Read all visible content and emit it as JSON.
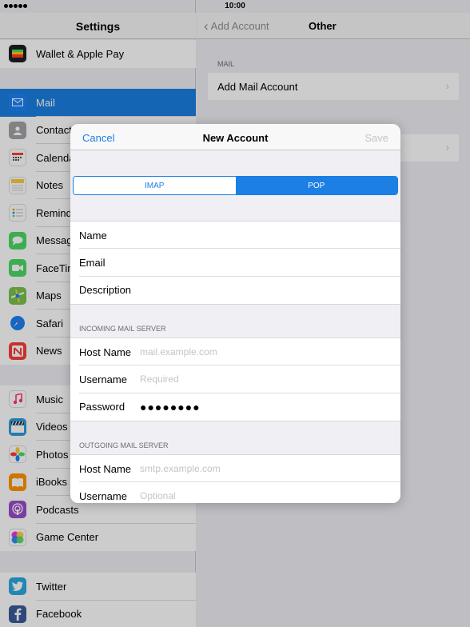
{
  "status_bar": {
    "time": "10:00"
  },
  "master": {
    "title": "Settings",
    "groups": [
      [
        {
          "label": "Wallet & Apple Pay",
          "icon": "wallet-icon",
          "color": "#1f1f1f"
        }
      ],
      [
        {
          "label": "Mail",
          "icon": "mail-icon",
          "color": "#1a82f7"
        },
        {
          "label": "Contacts",
          "icon": "contacts-icon",
          "color": "#8e8e93"
        },
        {
          "label": "Calendar",
          "icon": "calendar-icon",
          "color": "#ffffff"
        },
        {
          "label": "Notes",
          "icon": "notes-icon",
          "color": "#fccb3e"
        },
        {
          "label": "Reminders",
          "icon": "reminders-icon",
          "color": "#ffffff"
        },
        {
          "label": "Messages",
          "icon": "messages-icon",
          "color": "#4cd964"
        },
        {
          "label": "FaceTime",
          "icon": "facetime-icon",
          "color": "#4cd964"
        },
        {
          "label": "Maps",
          "icon": "maps-icon",
          "color": "#7ac24d"
        },
        {
          "label": "Safari",
          "icon": "safari-icon",
          "color": "#1a82f7"
        },
        {
          "label": "News",
          "icon": "news-icon",
          "color": "#fc3d39"
        }
      ],
      [
        {
          "label": "Music",
          "icon": "music-icon",
          "color": "#ffffff"
        },
        {
          "label": "Videos",
          "icon": "videos-icon",
          "color": "#2d9cdb"
        },
        {
          "label": "Photos",
          "icon": "photos-icon",
          "color": "#ffffff"
        },
        {
          "label": "iBooks",
          "icon": "ibooks-icon",
          "color": "#ff9500"
        },
        {
          "label": "Podcasts",
          "icon": "podcasts-icon",
          "color": "#9c4dcc"
        },
        {
          "label": "Game Center",
          "icon": "game-center-icon",
          "color": "#ffffff"
        }
      ],
      [
        {
          "label": "Twitter",
          "icon": "twitter-icon",
          "color": "#2aa9e0"
        },
        {
          "label": "Facebook",
          "icon": "facebook-icon",
          "color": "#3b5998"
        }
      ]
    ]
  },
  "detail": {
    "back_label": "Add Account",
    "title": "Other",
    "mail_section": "MAIL",
    "add_mail_account": "Add Mail Account"
  },
  "modal": {
    "cancel": "Cancel",
    "title": "New Account",
    "save": "Save",
    "segments": {
      "imap": "IMAP",
      "pop": "POP",
      "selected": "POP"
    },
    "account_fields": [
      {
        "label": "Name"
      },
      {
        "label": "Email"
      },
      {
        "label": "Description"
      }
    ],
    "incoming_header": "INCOMING MAIL SERVER",
    "incoming": {
      "host_label": "Host Name",
      "host_placeholder": "mail.example.com",
      "username_label": "Username",
      "username_placeholder": "Required",
      "password_label": "Password",
      "password_value": "●●●●●●●●"
    },
    "outgoing_header": "OUTGOING MAIL SERVER",
    "outgoing": {
      "host_label": "Host Name",
      "host_placeholder": "smtp.example.com",
      "username_label": "Username",
      "username_placeholder": "Optional"
    }
  },
  "colors": {
    "accent": "#1b7fe3",
    "background": "#efeff4",
    "separator": "#c8c7cc"
  }
}
